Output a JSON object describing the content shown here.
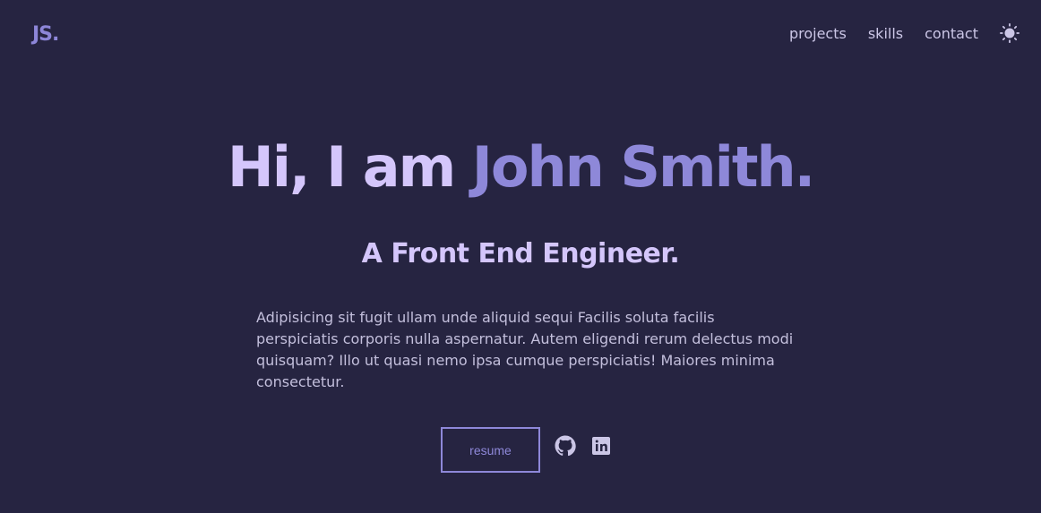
{
  "header": {
    "logo": "JS.",
    "nav": [
      "projects",
      "skills",
      "contact"
    ],
    "theme_icon": "sun-icon"
  },
  "hero": {
    "greeting": "Hi, I am ",
    "name": "John Smith.",
    "role": "A Front End Engineer.",
    "description": "Adipisicing sit fugit ullam unde aliquid sequi Facilis soluta facilis perspiciatis corporis nulla aspernatur. Autem eligendi rerum delectus modi quisquam? Illo ut quasi nemo ipsa cumque perspiciatis! Maiores minima consectetur.",
    "resume_label": "resume",
    "social_icons": [
      "github-icon",
      "linkedin-icon"
    ]
  },
  "colors": {
    "background": "#262441",
    "accent": "#8e88d9",
    "heading": "#d4c6fb"
  }
}
